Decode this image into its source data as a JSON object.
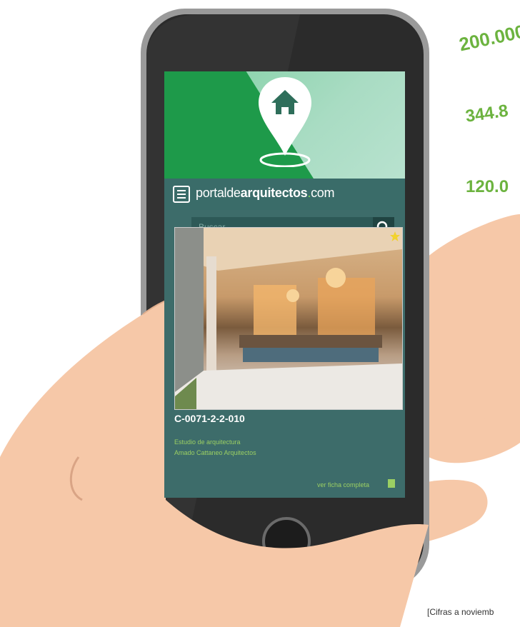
{
  "stats": [
    "200.000",
    "344.8",
    "120.0"
  ],
  "site": {
    "brand_light": "portalde",
    "brand_bold": "arquitectos",
    "brand_dot": ".",
    "brand_tld": "com",
    "search_placeholder": "Buscar..."
  },
  "listing": {
    "code": "C-0071-2-2-010",
    "category": "Estudio de arquitectura",
    "studio": "Amado Cattaneo Arquitectos",
    "more_link": "ver ficha completa"
  },
  "footnote": "[Cifras a noviemb",
  "colors": {
    "stat_green": "#6cb33f",
    "hero_green": "#1e9a4a",
    "screen_teal": "#3d6c6a",
    "link_green": "#9bcf63",
    "hand_skin": "#f6c8a8",
    "phone_body": "#2b2b2b"
  },
  "icons": [
    "home-pin-icon",
    "menu-icon",
    "search-icon",
    "star-icon",
    "document-icon",
    "home-button"
  ]
}
